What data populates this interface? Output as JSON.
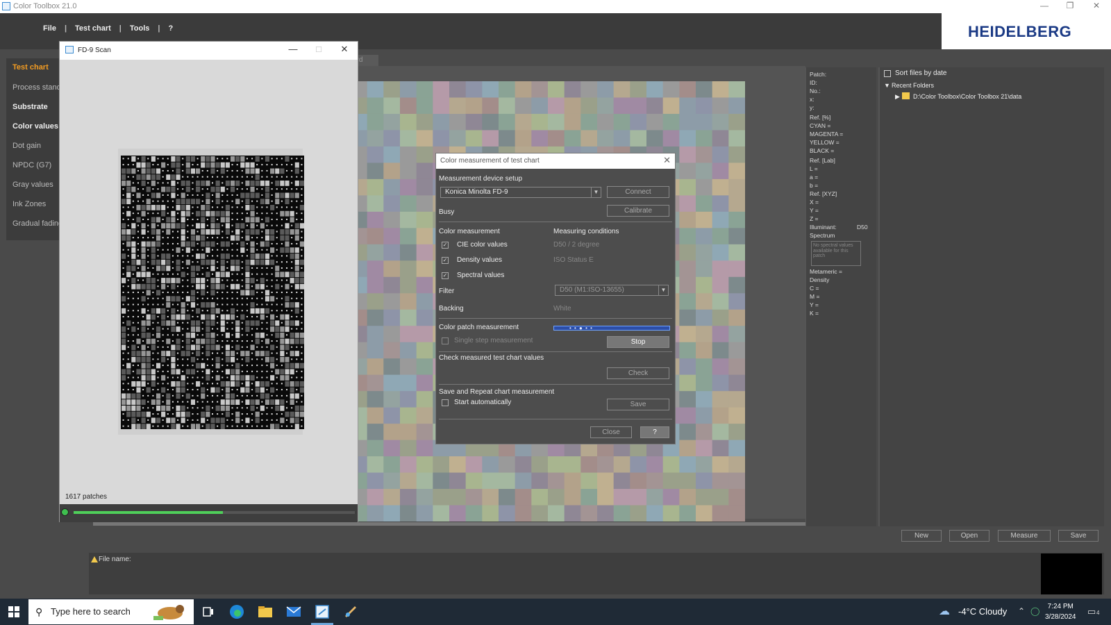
{
  "window": {
    "title": "Color Toolbox 21.0"
  },
  "menu": {
    "items": [
      "File",
      "Test chart",
      "Tools",
      "?"
    ]
  },
  "logo": {
    "text": "HEIDELBERG"
  },
  "leftnav": {
    "items": [
      "Test chart",
      "Process standard",
      "Substrate",
      "Color values",
      "Dot gain",
      "NPDC (G7)",
      "Gray values",
      "Ink Zones",
      "Gradual fading"
    ]
  },
  "tab_fragment": "ard",
  "scan_window": {
    "title": "FD-9 Scan",
    "patch_count": "1617 patches",
    "progress_fraction": 0.53
  },
  "dialog": {
    "title": "Color measurement of test chart",
    "device_setup_label": "Measurement device setup",
    "device_value": "Konica Minolta FD-9",
    "connect": "Connect",
    "status": "Busy",
    "calibrate": "Calibrate",
    "color_measurement_label": "Color measurement",
    "measuring_conditions_label": "Measuring conditions",
    "cie": "CIE color values",
    "density": "Density values",
    "spectral": "Spectral values",
    "cond_cie": "D50 / 2 degree",
    "cond_density": "ISO Status E",
    "filter_label": "Filter",
    "filter_value": "D50 (M1:ISO-13655)",
    "backing_label": "Backing",
    "backing_value": "White",
    "patch_measurement_label": "Color patch measurement",
    "single_step": "Single step measurement",
    "stop": "Stop",
    "check_label": "Check measured test chart values",
    "check": "Check",
    "save_label": "Save and Repeat chart measurement",
    "start_auto": "Start automatically",
    "save": "Save",
    "close": "Close",
    "help": "?"
  },
  "patch_info": {
    "lines": [
      "Patch:",
      "ID:",
      "No.:",
      "x:",
      "y:",
      "Ref. [%]",
      "CYAN =",
      "MAGENTA =",
      "YELLOW =",
      "BLACK =",
      "Ref. [Lab]",
      "L =",
      "a =",
      "b =",
      "Ref. [XYZ]",
      "X =",
      "Y =",
      "Z ="
    ],
    "illuminant_label": "Illuminant:",
    "illuminant_value": "D50",
    "spectrum_label": "Spectrum",
    "spectrum_note": "No spectral values available for this patch",
    "metameric": "Metameric =",
    "density_label": "Density",
    "density_lines": [
      "C =",
      "M =",
      "Y =",
      "K ="
    ]
  },
  "files": {
    "sort_label": "Sort files by date",
    "recent_label": "Recent Folders",
    "folder_path": "D:\\Color Toolbox\\Color Toolbox 21\\data"
  },
  "bottom_buttons": [
    "New",
    "Open",
    "Measure",
    "Save"
  ],
  "filename": {
    "label": "File name:"
  },
  "taskbar": {
    "search_placeholder": "Type here to search",
    "weather": "-4°C  Cloudy",
    "time": "7:24 PM",
    "date": "3/28/2024",
    "notification_count": "4"
  },
  "colors": {
    "accent": "#f39c22",
    "brand": "#1b3a85",
    "progress": "#4fcf5a"
  }
}
